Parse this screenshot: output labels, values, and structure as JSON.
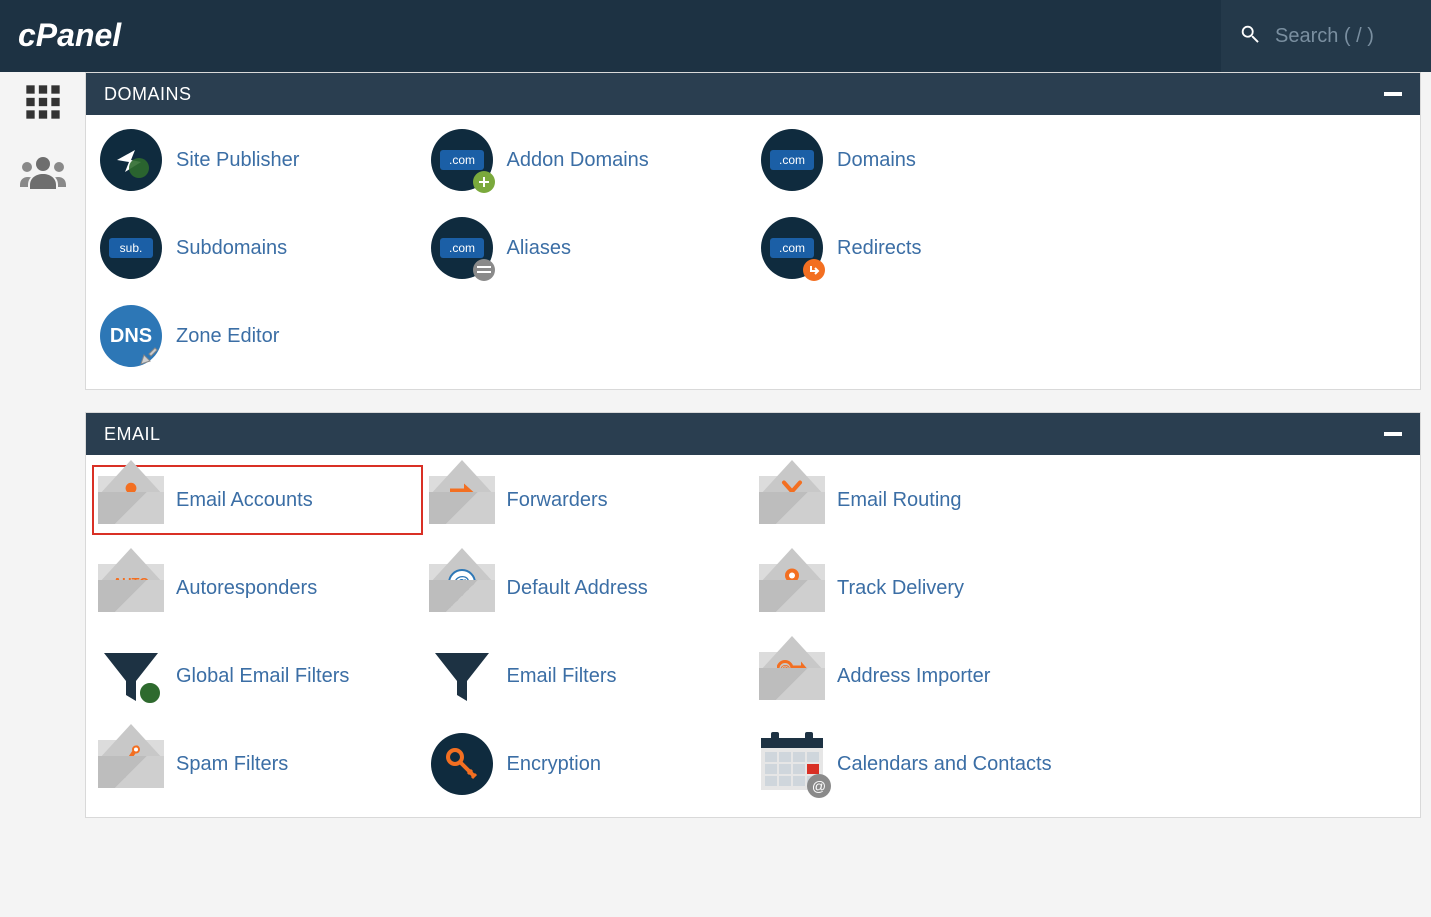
{
  "brand": "cPanel",
  "search": {
    "placeholder": "Search ( / )"
  },
  "panels": {
    "domains": {
      "title": "DOMAINS",
      "items": [
        {
          "label": "Site Publisher"
        },
        {
          "label": "Addon Domains"
        },
        {
          "label": "Domains"
        },
        {
          "label": "Subdomains"
        },
        {
          "label": "Aliases"
        },
        {
          "label": "Redirects"
        },
        {
          "label": "Zone Editor"
        }
      ]
    },
    "email": {
      "title": "EMAIL",
      "items": [
        {
          "label": "Email Accounts"
        },
        {
          "label": "Forwarders"
        },
        {
          "label": "Email Routing"
        },
        {
          "label": "Autoresponders"
        },
        {
          "label": "Default Address"
        },
        {
          "label": "Track Delivery"
        },
        {
          "label": "Global Email Filters"
        },
        {
          "label": "Email Filters"
        },
        {
          "label": "Address Importer"
        },
        {
          "label": "Spam Filters"
        },
        {
          "label": "Encryption"
        },
        {
          "label": "Calendars and Contacts"
        }
      ]
    }
  },
  "colors": {
    "headerBg": "#1d3243",
    "panelHeaderBg": "#2a3e50",
    "link": "#3b6ea5",
    "highlight": "#d93025",
    "darkCircle": "#0f2b3e",
    "accentOrange": "#f36f21"
  }
}
